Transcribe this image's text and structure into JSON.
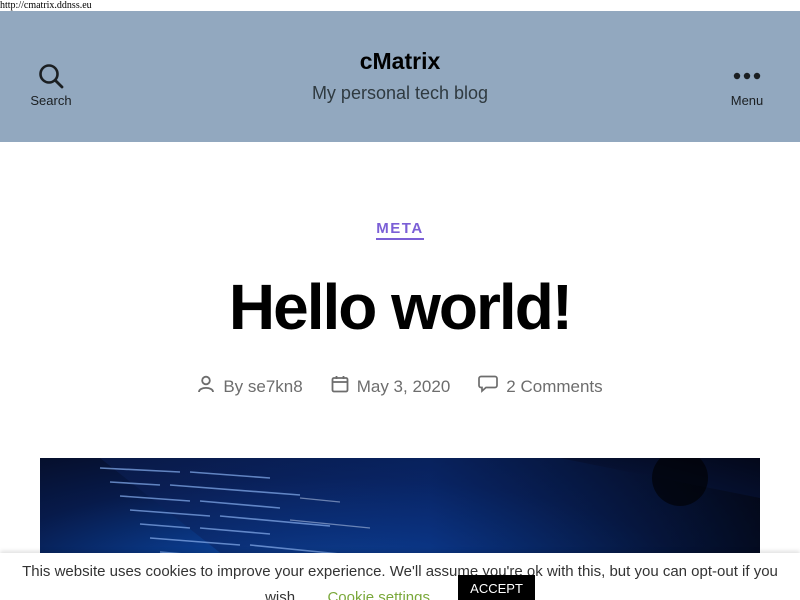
{
  "browser": {
    "url": "http://cmatrix.ddnss.eu"
  },
  "header": {
    "search_label": "Search",
    "menu_label": "Menu",
    "site_title": "cMatrix",
    "site_description": "My personal tech blog",
    "background": "#92a8bf"
  },
  "post": {
    "category": "META",
    "title": "Hello world!",
    "author": "By se7kn8",
    "date": "May 3, 2020",
    "comments": "2 Comments",
    "accent_color": "#7b5fd6"
  },
  "cookie_notice": {
    "message": "This website uses cookies to improve your experience. We'll assume you're ok with this, but you can opt-out if you",
    "message_tail": "wish.",
    "settings_label": "Cookie settings",
    "accept_label": "ACCEPT"
  },
  "icons": {
    "search": "search-icon",
    "menu": "menu-dots-icon",
    "author": "person-icon",
    "date": "calendar-icon",
    "comments": "comment-bubble-icon"
  }
}
